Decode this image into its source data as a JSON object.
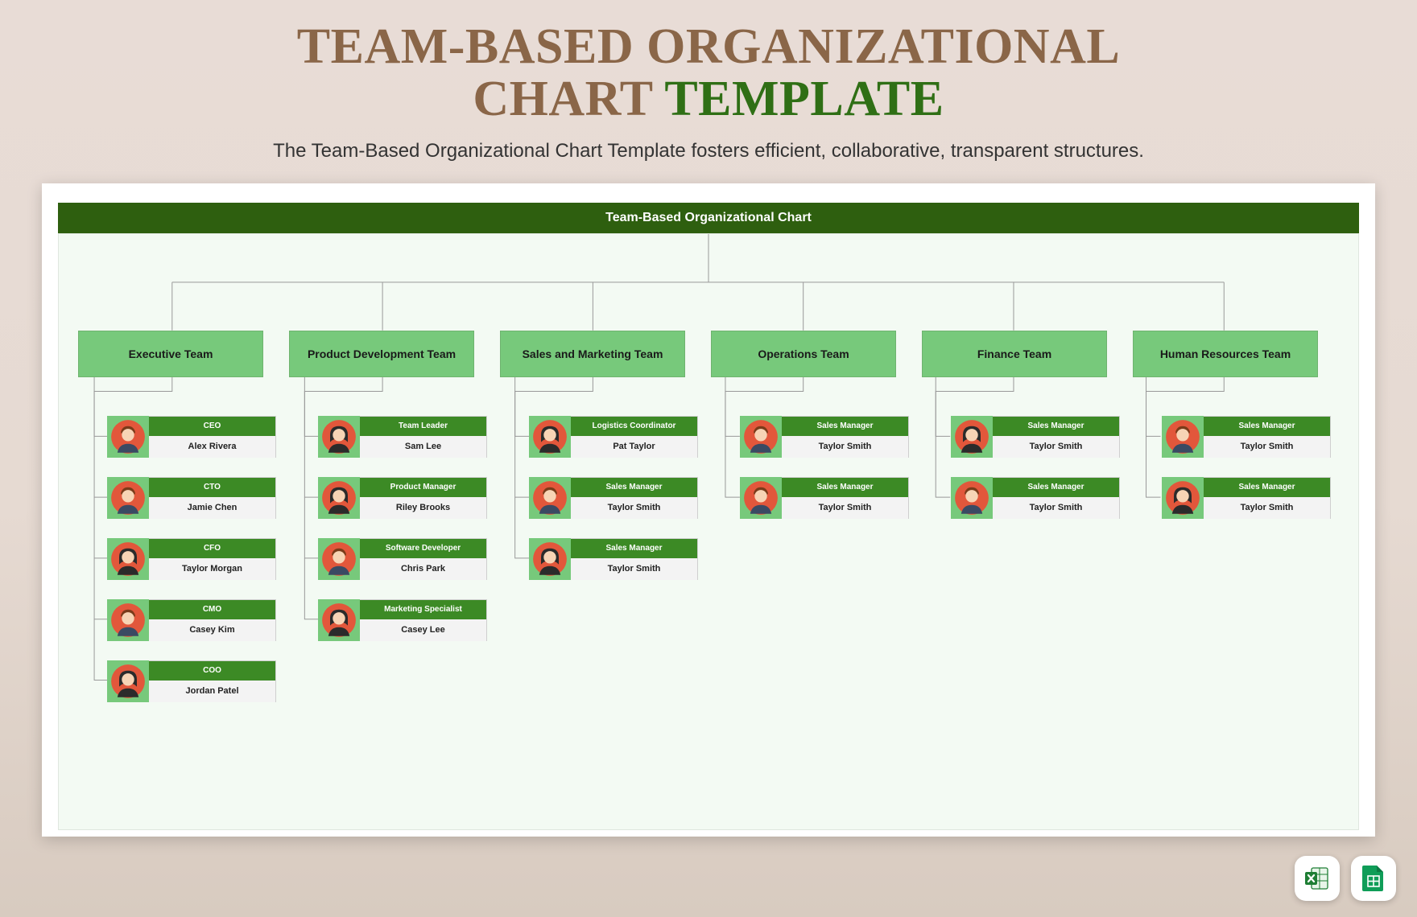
{
  "header": {
    "title_line1": "TEAM-BASED ORGANIZATIONAL",
    "title_line2a": "CHART ",
    "title_line2b": "TEMPLATE",
    "subtitle": "The Team-Based Organizational Chart Template fosters efficient, collaborative, transparent structures."
  },
  "chart": {
    "inner_title": "Team-Based Organizational Chart",
    "teams": [
      {
        "label": "Executive Team",
        "members": [
          {
            "role": "CEO",
            "name": "Alex Rivera",
            "avatar": "m"
          },
          {
            "role": "CTO",
            "name": "Jamie Chen",
            "avatar": "m"
          },
          {
            "role": "CFO",
            "name": "Taylor Morgan",
            "avatar": "f"
          },
          {
            "role": "CMO",
            "name": "Casey Kim",
            "avatar": "m"
          },
          {
            "role": "COO",
            "name": "Jordan Patel",
            "avatar": "f"
          }
        ]
      },
      {
        "label": "Product Development Team",
        "members": [
          {
            "role": "Team Leader",
            "name": "Sam Lee",
            "avatar": "f"
          },
          {
            "role": "Product Manager",
            "name": "Riley Brooks",
            "avatar": "f"
          },
          {
            "role": "Software Developer",
            "name": "Chris Park",
            "avatar": "m"
          },
          {
            "role": "Marketing Specialist",
            "name": "Casey Lee",
            "avatar": "f"
          }
        ]
      },
      {
        "label": "Sales and Marketing Team",
        "members": [
          {
            "role": "Logistics Coordinator",
            "name": "Pat Taylor",
            "avatar": "f"
          },
          {
            "role": "Sales Manager",
            "name": "Taylor Smith",
            "avatar": "m"
          },
          {
            "role": "Sales Manager",
            "name": "Taylor Smith",
            "avatar": "f"
          }
        ]
      },
      {
        "label": "Operations Team",
        "members": [
          {
            "role": "Sales Manager",
            "name": "Taylor Smith",
            "avatar": "m"
          },
          {
            "role": "Sales Manager",
            "name": "Taylor Smith",
            "avatar": "m"
          }
        ]
      },
      {
        "label": "Finance Team",
        "members": [
          {
            "role": "Sales Manager",
            "name": "Taylor Smith",
            "avatar": "f"
          },
          {
            "role": "Sales Manager",
            "name": "Taylor Smith",
            "avatar": "m"
          }
        ]
      },
      {
        "label": "Human Resources Team",
        "members": [
          {
            "role": "Sales Manager",
            "name": "Taylor Smith",
            "avatar": "m"
          },
          {
            "role": "Sales Manager",
            "name": "Taylor Smith",
            "avatar": "f"
          }
        ]
      }
    ]
  },
  "badges": {
    "excel": "Excel",
    "sheets": "Sheets"
  },
  "colors": {
    "brown": "#8a6648",
    "green_accent": "#2f6f15",
    "team_box": "#77c97b",
    "role_bg": "#3c8a25",
    "dark_green": "#2e5f0f"
  }
}
